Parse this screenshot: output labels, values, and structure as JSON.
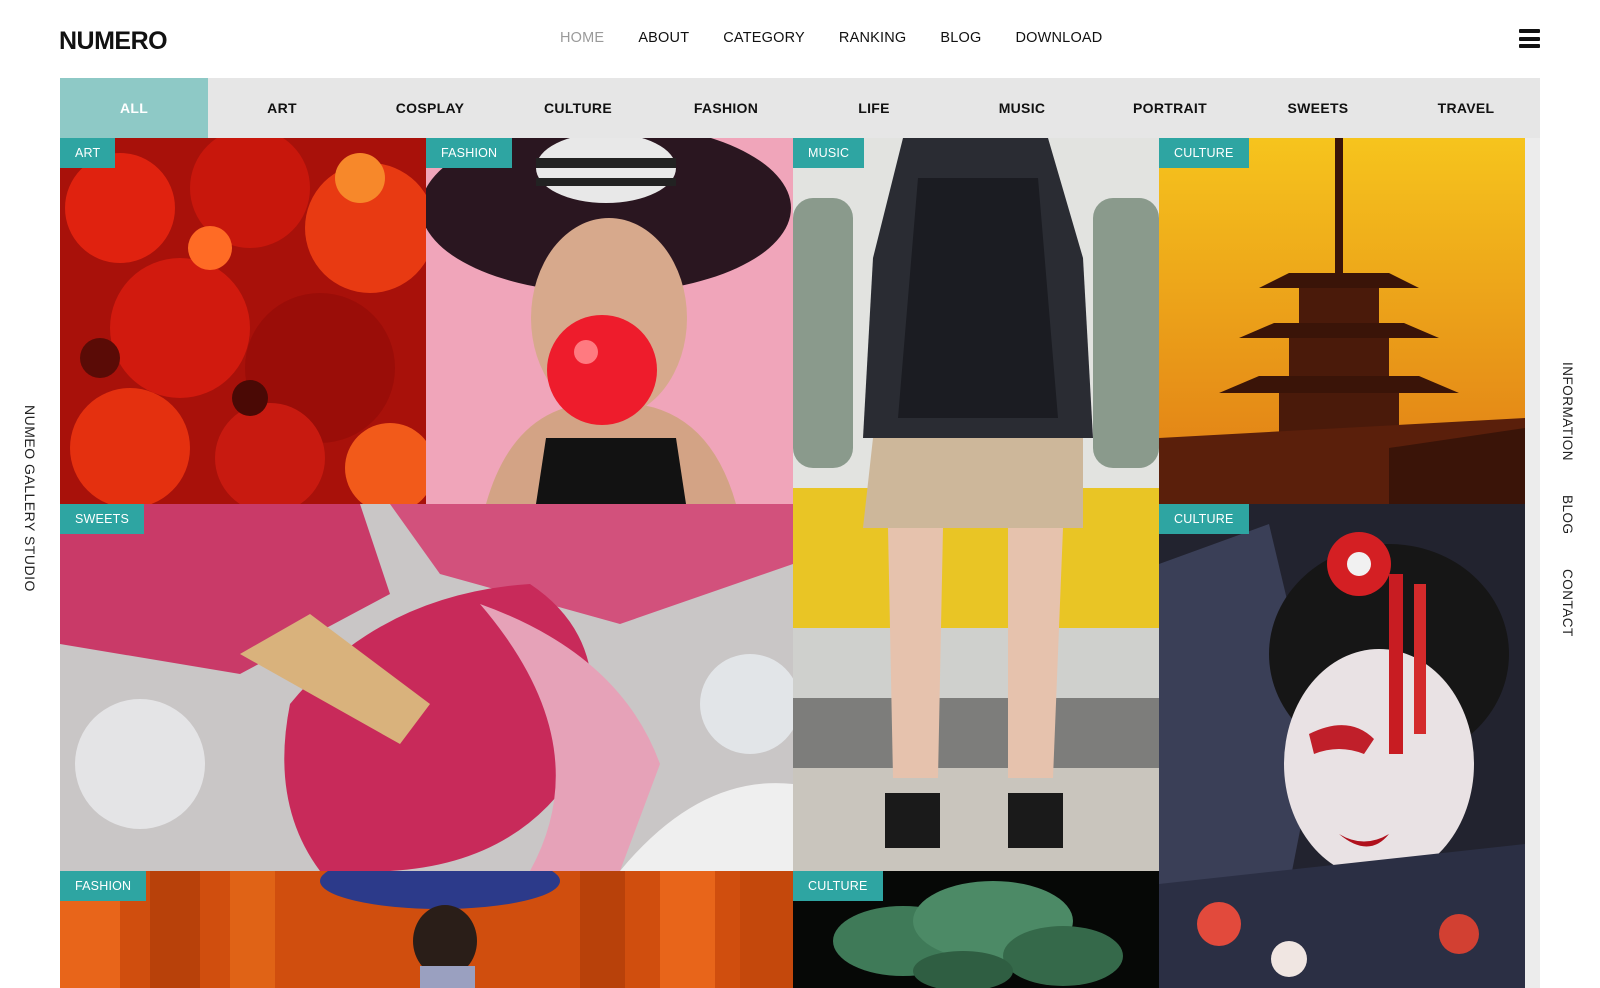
{
  "header": {
    "logo": "NUMERO",
    "nav": [
      "HOME",
      "ABOUT",
      "CATEGORY",
      "RANKING",
      "BLOG",
      "DOWNLOAD"
    ],
    "active_nav": "HOME",
    "menu_icon": "hamburger-menu-icon"
  },
  "categories": {
    "items": [
      "ALL",
      "ART",
      "COSPLAY",
      "CULTURE",
      "FASHION",
      "LIFE",
      "MUSIC",
      "PORTRAIT",
      "SWEETS",
      "TRAVEL"
    ],
    "active": "ALL"
  },
  "side_left": "NUMEO GALLERY STUDIO",
  "side_right": [
    "INFORMATION",
    "BLOG",
    "CONTACT"
  ],
  "gallery": [
    {
      "tag": "ART"
    },
    {
      "tag": "FASHION"
    },
    {
      "tag": "MUSIC"
    },
    {
      "tag": "CULTURE"
    },
    {
      "tag": "SWEETS"
    },
    {
      "tag": "CULTURE"
    },
    {
      "tag": "FASHION"
    },
    {
      "tag": "CULTURE"
    }
  ],
  "colors": {
    "tag_bg": "#2ea5a2",
    "active_category_bg": "#8ec9c6",
    "category_bar_bg": "#e6e6e6",
    "inactive_nav": "#9a9a9a"
  }
}
